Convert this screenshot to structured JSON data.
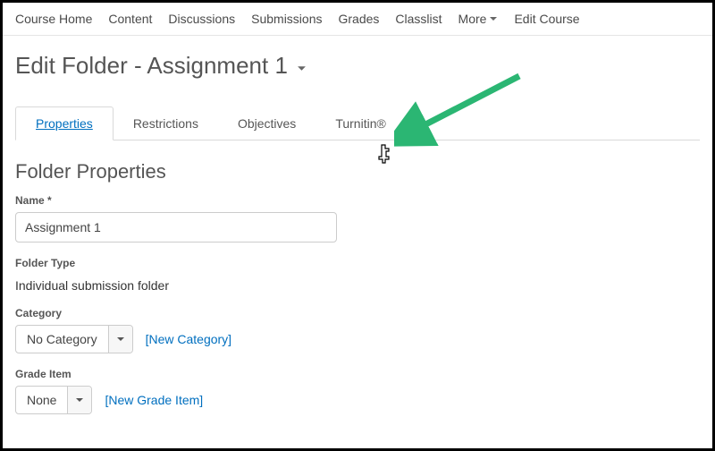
{
  "nav": {
    "items": [
      "Course Home",
      "Content",
      "Discussions",
      "Submissions",
      "Grades",
      "Classlist",
      "More",
      "Edit Course"
    ]
  },
  "page": {
    "title": "Edit Folder - Assignment 1"
  },
  "tabs": {
    "items": [
      "Properties",
      "Restrictions",
      "Objectives",
      "Turnitin®"
    ],
    "active_index": 0
  },
  "folder_properties": {
    "heading": "Folder Properties",
    "name_label": "Name",
    "name_required": "*",
    "name_value": "Assignment 1",
    "folder_type_label": "Folder Type",
    "folder_type_value": "Individual submission folder",
    "category_label": "Category",
    "category_value": "No Category",
    "new_category_link": "[New Category]",
    "grade_item_label": "Grade Item",
    "grade_item_value": "None",
    "new_grade_item_link": "[New Grade Item]"
  },
  "annotation": {
    "arrow_color": "#2bb673"
  }
}
